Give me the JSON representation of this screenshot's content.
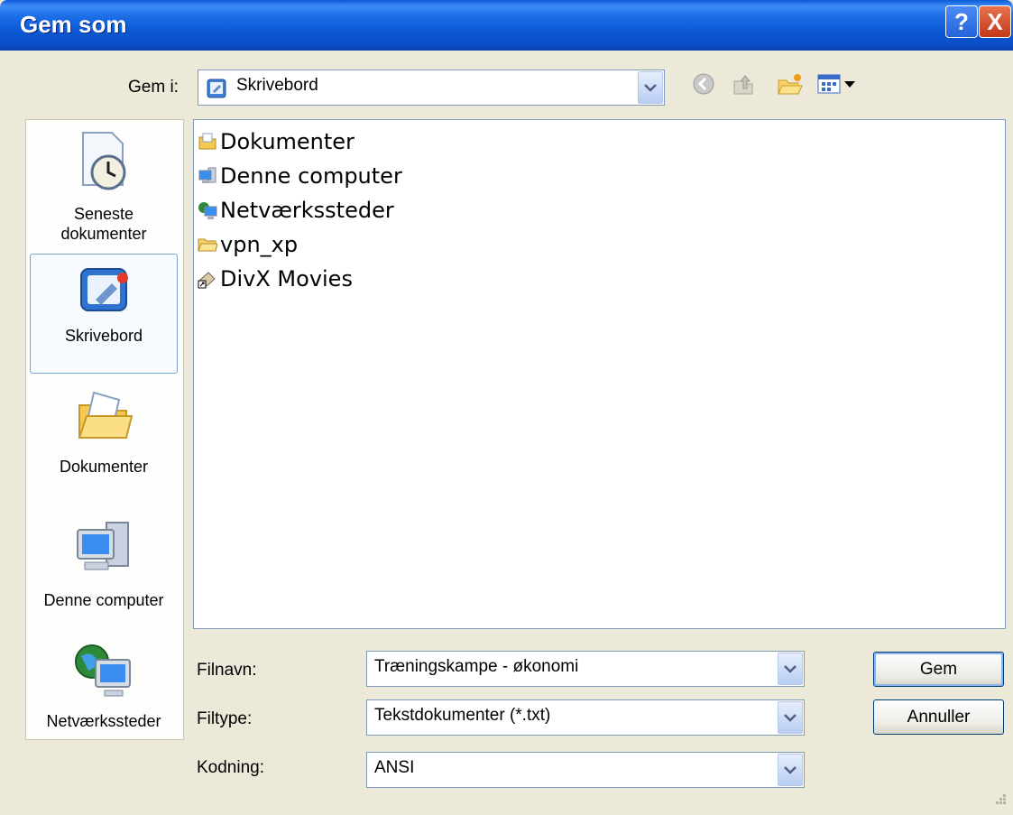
{
  "window": {
    "title": "Gem som"
  },
  "titlebar_buttons": {
    "help": "?",
    "close": "X"
  },
  "save_in": {
    "label": "Gem i:",
    "value": "Skrivebord"
  },
  "toolbar": {
    "icons": [
      "back-icon",
      "up-folder-icon",
      "new-folder-icon",
      "view-menu-icon"
    ]
  },
  "places": [
    {
      "label": "Seneste dokumenter",
      "icon": "recent-documents-icon"
    },
    {
      "label": "Skrivebord",
      "icon": "desktop-icon"
    },
    {
      "label": "Dokumenter",
      "icon": "my-documents-icon"
    },
    {
      "label": "Denne computer",
      "icon": "my-computer-icon"
    },
    {
      "label": "Netværkssteder",
      "icon": "network-places-icon"
    }
  ],
  "files": [
    {
      "name": "Dokumenter",
      "icon": "my-documents-icon"
    },
    {
      "name": "Denne computer",
      "icon": "my-computer-icon"
    },
    {
      "name": "Netværkssteder",
      "icon": "network-places-icon"
    },
    {
      "name": "vpn_xp",
      "icon": "folder-icon"
    },
    {
      "name": "DivX Movies",
      "icon": "shortcut-icon"
    }
  ],
  "form": {
    "filename_label": "Filnavn:",
    "filename_value": "Træningskampe - økonomi",
    "filetype_label": "Filtype:",
    "filetype_value": "Tekstdokumenter (*.txt)",
    "encoding_label": "Kodning:",
    "encoding_value": "ANSI"
  },
  "buttons": {
    "save": "Gem",
    "cancel": "Annuller"
  }
}
